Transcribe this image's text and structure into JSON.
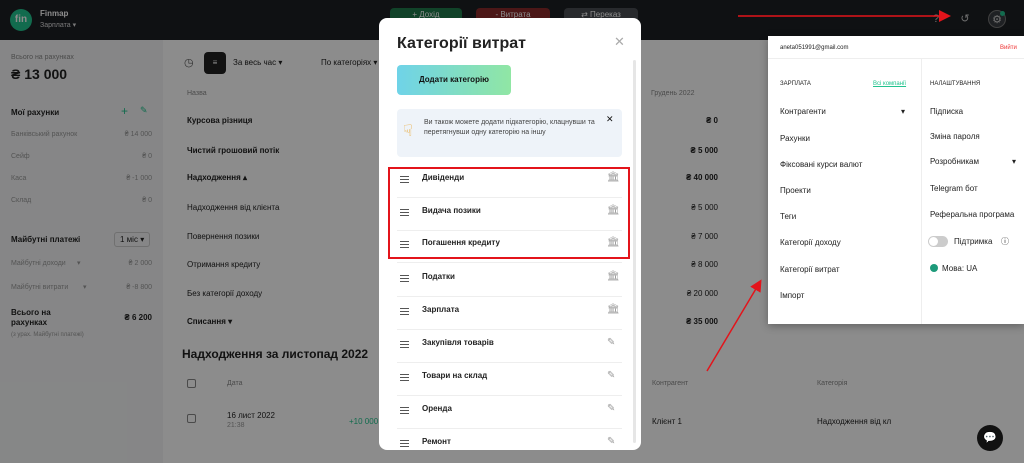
{
  "app": {
    "logo": "fin",
    "name": "Finmap",
    "project": "Зарплата"
  },
  "topbar": {
    "btn_income": "+ Дохід",
    "btn_expense": "- Витрата",
    "btn_transfer": "⇄ Переказ"
  },
  "sidebar": {
    "total_label": "Всього на рахунках",
    "total_value": "₴ 13 000",
    "accounts_title": "Мої рахунки",
    "accounts": [
      {
        "name": "Банківський рахунок",
        "value": "₴ 14 000"
      },
      {
        "name": "Сейф",
        "value": "₴ 0"
      },
      {
        "name": "Каса",
        "value": "₴ -1 000"
      },
      {
        "name": "Склад",
        "value": "₴ 0"
      }
    ],
    "future_title": "Майбутні платежі",
    "future_period": "1 міс",
    "future_income_label": "Майбутні доходи",
    "future_income_value": "₴ 2 000",
    "future_expense_label": "Майбутні витрати",
    "future_expense_value": "₴ -8 800",
    "grand_label": "Всього на рахунках",
    "grand_value": "₴ 6 200",
    "grand_sub": "(з урах. Майбутні платежі)"
  },
  "main": {
    "period_filter": "За весь час",
    "category_filter": "По категоріях",
    "col_name": "Назва",
    "col_month": "Грудень 2022",
    "rows": [
      {
        "name": "Курсова різниця",
        "value": "₴ 0"
      },
      {
        "name": "Чистий грошовий потік",
        "value": "₴ 5 000"
      },
      {
        "name": "Надходження",
        "value": "₴ 40 000"
      },
      {
        "name": "Надходження від клієнта",
        "value": "₴ 5 000"
      },
      {
        "name": "Повернення позики",
        "value": "₴ 7 000"
      },
      {
        "name": "Отримання кредиту",
        "value": "₴ 8 000"
      },
      {
        "name": "Без категорії доходу",
        "value": "₴ 20 000"
      },
      {
        "name": "Списання",
        "value": "₴ 35 000"
      }
    ],
    "section_title": "Надходження за листопад 2022",
    "th_date": "Дата",
    "th_counterparty": "Контрагент",
    "th_category": "Категорія",
    "tx_date": "16 лист 2022",
    "tx_time": "21:38",
    "tx_amount": "+10 000",
    "tx_counterparty": "Клієнт 1",
    "tx_category": "Надходження від кл"
  },
  "dropdown": {
    "email": "aneta051991@gmail.com",
    "logout": "Вийти",
    "section_project": "ЗАРПЛАТА",
    "all_companies": "Всі компанії",
    "section_settings": "НАЛАШТУВАННЯ",
    "left_items": [
      "Контрагенти",
      "Рахунки",
      "Фіксовані курси валют",
      "Проекти",
      "Теги",
      "Категорії доходу",
      "Категорії витрат",
      "Імпорт"
    ],
    "right_items": [
      "Підписка",
      "Зміна пароля",
      "Розробникам",
      "Telegram бот",
      "Реферальна програма"
    ],
    "support": "Підтримка",
    "language": "Мова: UA"
  },
  "modal": {
    "title": "Категорії витрат",
    "add_button": "Додати категорію",
    "hint": "Ви також можете додати підкатегорію, клацнувши та перетягнувши одну категорію на іншу",
    "categories": [
      {
        "name": "Дивіденди",
        "icon": "bank-icon"
      },
      {
        "name": "Видача позики",
        "icon": "bank-icon"
      },
      {
        "name": "Погашення кредиту",
        "icon": "bank-icon"
      },
      {
        "name": "Податки",
        "icon": "bank-icon"
      },
      {
        "name": "Зарплата",
        "icon": "bank-icon"
      },
      {
        "name": "Закупівля товарів",
        "icon": "pencil-icon"
      },
      {
        "name": "Товари на склад",
        "icon": "pencil-icon"
      },
      {
        "name": "Оренда",
        "icon": "pencil-icon"
      },
      {
        "name": "Ремонт",
        "icon": "pencil-icon"
      }
    ]
  },
  "colors": {
    "accent": "#22c38e",
    "highlight": "#e3141b"
  }
}
